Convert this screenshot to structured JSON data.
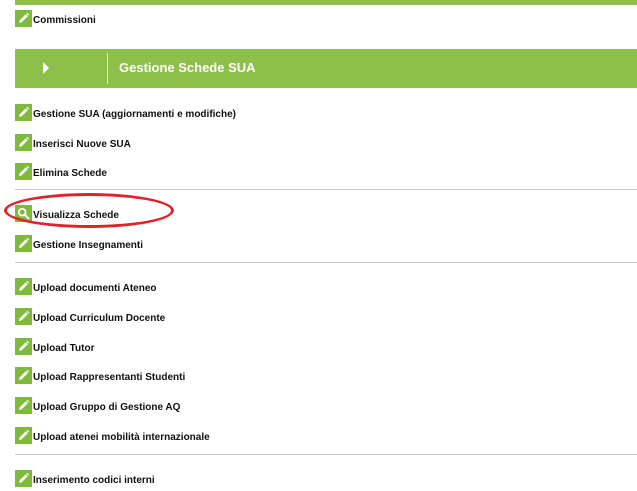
{
  "top_item": {
    "label": "Commissioni",
    "icon": "pencil-icon"
  },
  "banner": {
    "title": "Gestione Schede SUA",
    "icon": "play-arrow-icon"
  },
  "group1": [
    {
      "label": "Gestione SUA (aggiornamenti e modifiche)",
      "icon": "pencil-icon"
    },
    {
      "label": "Inserisci Nuove SUA",
      "icon": "pencil-icon"
    },
    {
      "label": "Elimina Schede",
      "icon": "pencil-icon"
    }
  ],
  "group2": [
    {
      "label": "Visualizza Schede",
      "icon": "magnifier-icon"
    },
    {
      "label": "Gestione Insegnamenti",
      "icon": "pencil-icon"
    }
  ],
  "group3": [
    {
      "label": "Upload documenti Ateneo",
      "icon": "pencil-icon"
    },
    {
      "label": "Upload Curriculum Docente",
      "icon": "pencil-icon"
    },
    {
      "label": "Upload Tutor",
      "icon": "pencil-icon"
    },
    {
      "label": "Upload Rappresentanti Studenti",
      "icon": "pencil-icon"
    },
    {
      "label": "Upload Gruppo di Gestione AQ",
      "icon": "pencil-icon"
    },
    {
      "label": "Upload atenei mobilità internazionale",
      "icon": "pencil-icon"
    }
  ],
  "group4": [
    {
      "label": "Inserimento codici interni",
      "icon": "pencil-icon"
    }
  ],
  "colors": {
    "accent": "#8dbf4a",
    "icon": "#7fba3d",
    "highlight": "#e0232b"
  }
}
